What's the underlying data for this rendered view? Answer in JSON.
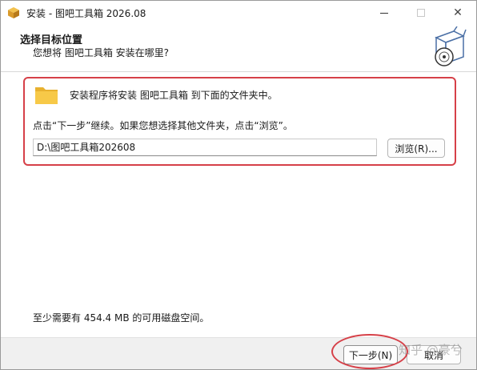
{
  "window": {
    "title": "安装 - 图吧工具箱 2026.08",
    "minimize_icon": "minimize-icon",
    "maximize_icon": "maximize-icon",
    "close_icon": "close-icon",
    "close_glyph": "✕"
  },
  "header": {
    "title": "选择目标位置",
    "subtitle": "您想将 图吧工具箱 安装在哪里?"
  },
  "main": {
    "intro": "安装程序将安装 图吧工具箱 到下面的文件夹中。",
    "continue_hint": "点击“下一步”继续。如果您想选择其他文件夹，点击“浏览”。",
    "path_value": "D:\\图吧工具箱202608",
    "browse_label": "浏览(R)...",
    "space_required": "至少需要有 454.4 MB 的可用磁盘空间。"
  },
  "footer": {
    "next_label": "下一步(N)",
    "cancel_label": "取消"
  },
  "watermark": {
    "text": "知乎 @豪兮"
  },
  "colors": {
    "highlight": "#d64048",
    "folder": "#f7c948",
    "footer_bg": "#f0f0f0"
  }
}
